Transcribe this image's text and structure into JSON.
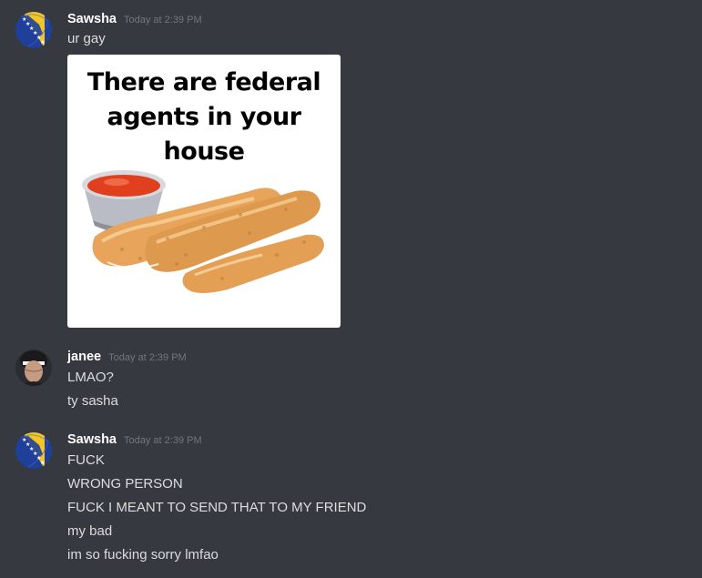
{
  "messages": [
    {
      "username": "Sawsha",
      "timestamp": "Today at 2:39 PM",
      "avatar": "bosnian-flag-avatar",
      "lines": [
        "ur gay"
      ],
      "image": {
        "caption_line1": "There are federal",
        "caption_line2": "agents in your house",
        "depicts": "mozzarella-sticks-with-marinara-sauce"
      }
    },
    {
      "username": "janee",
      "timestamp": "Today at 2:39 PM",
      "avatar": "person-photo-avatar",
      "lines": [
        "LMAO?",
        "ty sasha"
      ]
    },
    {
      "username": "Sawsha",
      "timestamp": "Today at 2:39 PM",
      "avatar": "bosnian-flag-avatar",
      "lines": [
        "FUCK",
        "WRONG PERSON",
        "FUCK I MEANT TO SEND THAT TO MY FRIEND",
        "my bad",
        "im so fucking sorry lmfao"
      ]
    }
  ],
  "colors": {
    "background": "#36393f",
    "username": "#ffffff",
    "timestamp": "#72767d",
    "message_text": "#dcddde",
    "flag_blue": "#1f3f9a",
    "flag_yellow": "#f3c623",
    "sauce": "#e0401e",
    "fried_food": "#e8a45a"
  }
}
